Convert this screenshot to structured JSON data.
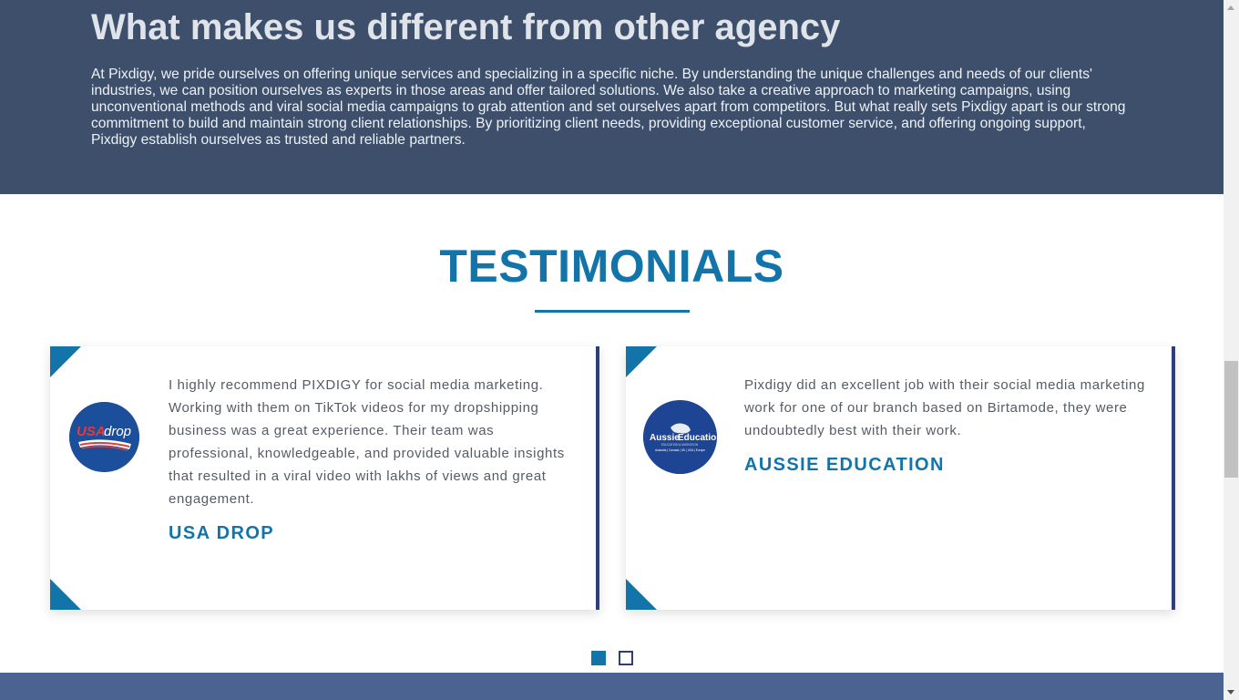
{
  "different_section": {
    "title": "What makes us different from other agency",
    "body": "At Pixdigy, we pride ourselves on offering unique services and specializing in a specific niche. By understanding the unique challenges and needs of our clients' industries, we can position ourselves as experts in those areas and offer tailored solutions. We also take a creative approach to marketing campaigns, using unconventional methods and viral social media campaigns to grab attention and set ourselves apart from competitors. But what really sets Pixdigy apart is our strong commitment to build and maintain strong client relationships. By prioritizing client needs, providing exceptional customer service, and offering ongoing support, Pixdigy establish ourselves as trusted and reliable partners."
  },
  "testimonials": {
    "heading": "TESTIMONIALS",
    "items": [
      {
        "quote": "I highly recommend PIXDIGY for social media marketing. Working with them on TikTok videos for my dropshipping business was a great experience. Their team was professional, knowledgeable, and provided valuable insights that resulted in a viral video with lakhs of views and great engagement.",
        "author": "USA DROP",
        "logo_text_a": "USA",
        "logo_text_b": "drop"
      },
      {
        "quote": "Pixdigy did an excellent job with their social media marketing work for one of our branch based on Birtamode, they were undoubtedly best with their work.",
        "author": "AUSSIE EDUCATION",
        "logo_text_a": "Aussie",
        "logo_text_b": "Education",
        "logo_tagline": "EDUCATION & MIGRATION",
        "logo_countries": "Australia | Canada | UK | USA | Europe"
      }
    ],
    "active_slide": 1,
    "slide_count": 2
  },
  "colors": {
    "accent": "#1374a9",
    "dark_section": "#3d4f6b",
    "card_border": "#2d3e78",
    "bottom_band": "#4a6390"
  }
}
